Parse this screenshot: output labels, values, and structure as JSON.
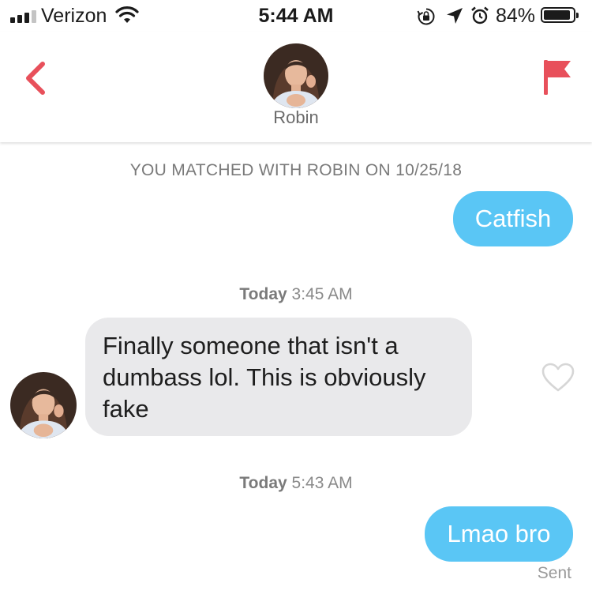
{
  "status_bar": {
    "carrier": "Verizon",
    "time": "5:44 AM",
    "battery_percent": "84%",
    "battery_level": 0.84,
    "icons": [
      "signal-icon",
      "wifi-icon",
      "rotation-lock-icon",
      "location-arrow-icon",
      "alarm-icon",
      "battery-icon"
    ]
  },
  "header": {
    "match_name": "Robin",
    "back_icon": "chevron-left-icon",
    "report_icon": "flag-icon",
    "accent_color": "#e8505b"
  },
  "conversation": {
    "matched_text": "YOU MATCHED WITH ROBIN ON 10/25/18",
    "messages": [
      {
        "direction": "outgoing",
        "text": "Catfish"
      },
      {
        "direction": "timestamp",
        "day": "Today",
        "time": "3:45 AM"
      },
      {
        "direction": "incoming",
        "text": "Finally someone that isn't a dumbass lol. This is obviously fake"
      },
      {
        "direction": "timestamp",
        "day": "Today",
        "time": "5:43 AM"
      },
      {
        "direction": "outgoing",
        "text": "Lmao bro",
        "status": "Sent"
      }
    ],
    "outgoing_color": "#5ac6f5",
    "incoming_color": "#e9e9eb",
    "like_icon": "heart-outline-icon"
  }
}
